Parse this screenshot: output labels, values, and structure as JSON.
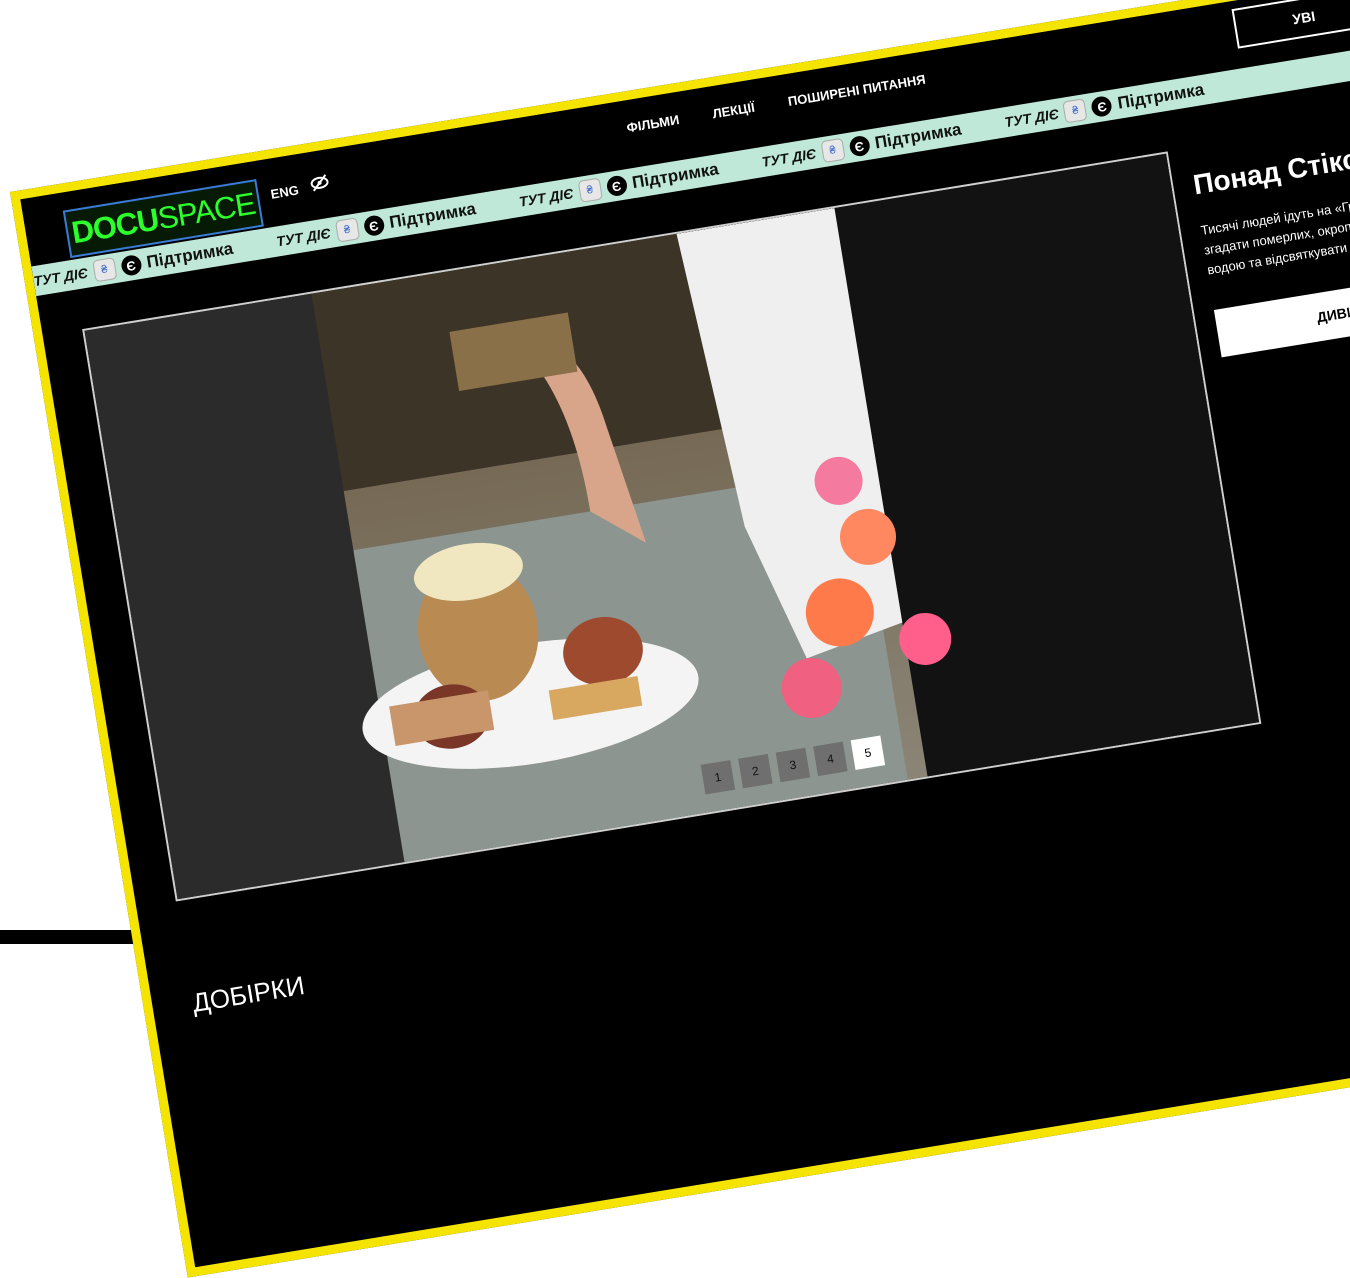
{
  "header": {
    "logo_bold": "DOCU",
    "logo_light": "SPACE",
    "lang": "ENG",
    "nav": [
      {
        "label": "ФІЛЬМИ"
      },
      {
        "label": "ЛЕКЦІЇ"
      },
      {
        "label": "ПОШИРЕНІ ПИТАННЯ"
      }
    ],
    "login_label": "УВІ"
  },
  "ticker": {
    "items": [
      {
        "prefix": "ТУТ ДІЄ",
        "label": "Підтримка"
      },
      {
        "prefix": "ТУТ ДІЄ",
        "label": "Підтримка"
      },
      {
        "prefix": "ТУТ ДІЄ",
        "label": "Підтримка"
      },
      {
        "prefix": "ТУТ ДІЄ",
        "label": "Підтримка"
      },
      {
        "prefix": "ТУТ ДІЄ",
        "label": "Підтримка"
      }
    ],
    "euro_symbol": "Є",
    "trident_symbol": "₴"
  },
  "featured": {
    "title": "Понад Стіксом",
    "description": "Тисячі людей ідуть на «Гробки», щоб згадати померлих, окропитися святою водою та відсвяткувати життя.",
    "cta": "ДИВИТИСЬ"
  },
  "pagination": {
    "pages": [
      "1",
      "2",
      "3",
      "4",
      "5"
    ],
    "active": "5"
  },
  "sections": {
    "collections_title": "ДОБІРКИ"
  },
  "colors": {
    "frame": "#f4e400",
    "ticker_bg": "#bfe8d8",
    "logo_green": "#2cff2c"
  }
}
